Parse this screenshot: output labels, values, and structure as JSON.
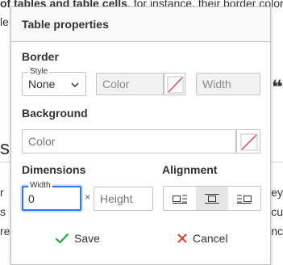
{
  "background": {
    "top_bold": "of tables and table cells",
    "top_rest": ". for instance. their border color a",
    "left_fragments": [
      "le",
      "s",
      "r",
      "s",
      "re"
    ],
    "right_fragments": [
      "ey",
      "s cu",
      "anc"
    ],
    "quote_glyph": "❝"
  },
  "dialog": {
    "title": "Table properties",
    "border": {
      "section_label": "Border",
      "style_float_label": "Style",
      "style_value": "None",
      "color_placeholder": "Color",
      "width_placeholder": "Width"
    },
    "background": {
      "section_label": "Background",
      "color_placeholder": "Color"
    },
    "dimensions": {
      "section_label": "Dimensions",
      "width_float_label": "Width",
      "width_value": "0",
      "times_sign": "×",
      "height_placeholder": "Height"
    },
    "alignment": {
      "section_label": "Alignment",
      "options": [
        "align-left",
        "align-center",
        "align-right"
      ],
      "selected": "align-center"
    },
    "footer": {
      "save_label": "Save",
      "cancel_label": "Cancel"
    }
  },
  "colors": {
    "save_check": "#1fa845",
    "cancel_x": "#e03d2c",
    "focus_border": "#2977ff",
    "strike_red": "#e8474d"
  }
}
